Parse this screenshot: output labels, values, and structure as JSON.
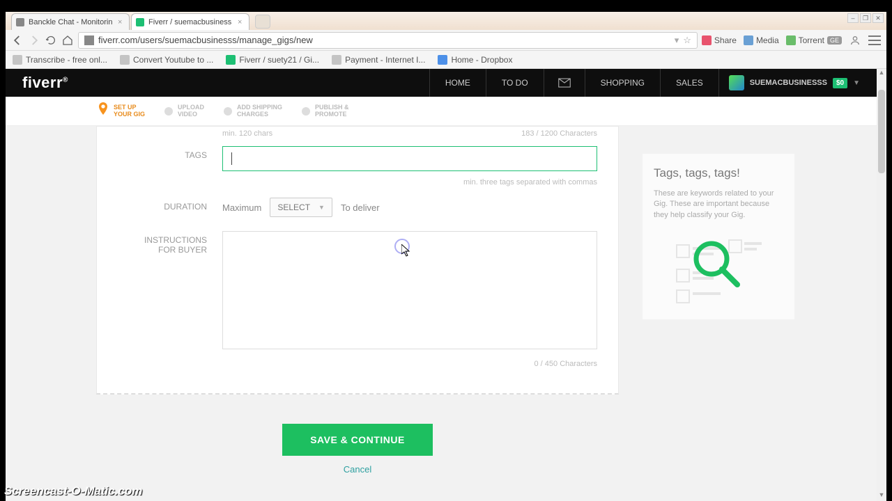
{
  "browser": {
    "tabs": [
      {
        "title": "Banckle Chat - Monitorin"
      },
      {
        "title": "Fiverr / suemacbusiness"
      }
    ],
    "url": "fiverr.com/users/suemacbusinesss/manage_gigs/new",
    "window_controls": {
      "min": "–",
      "max": "❐",
      "close": "✕"
    },
    "extensions": {
      "share": "Share",
      "media": "Media",
      "torrent": "Torrent",
      "ge": "GE"
    },
    "bookmarks": [
      "Transcribe - free onl...",
      "Convert Youtube to ...",
      "Fiverr / suety21 / Gi...",
      "Payment - Internet I...",
      "Home - Dropbox"
    ]
  },
  "nav": {
    "logo": "fiverr",
    "items": [
      "HOME",
      "TO DO",
      "SHOPPING",
      "SALES"
    ],
    "username": "SUEMACBUSINESSS",
    "balance": "$0"
  },
  "steps": [
    {
      "line1": "SET UP",
      "line2": "YOUR GIG",
      "active": true
    },
    {
      "line1": "UPLOAD",
      "line2": "VIDEO",
      "active": false
    },
    {
      "line1": "ADD SHIPPING",
      "line2": "CHARGES",
      "active": false
    },
    {
      "line1": "PUBLISH &",
      "line2": "PROMOTE",
      "active": false
    }
  ],
  "form": {
    "desc_min_hint": "min. 120 chars",
    "desc_counter": "183 / 1200 Characters",
    "tags_label": "TAGS",
    "tags_value": "",
    "tags_hint": "min. three tags separated with commas",
    "duration_label": "DURATION",
    "duration_max": "Maximum",
    "duration_select": "SELECT",
    "duration_deliver": "To deliver",
    "instructions_label1": "INSTRUCTIONS",
    "instructions_label2": "FOR BUYER",
    "instructions_value": "",
    "instructions_counter": "0 / 450 Characters",
    "save_btn": "SAVE & CONTINUE",
    "cancel_btn": "Cancel"
  },
  "tip": {
    "title": "Tags, tags, tags!",
    "text": "These are keywords related to your Gig. These are important because they help classify your Gig."
  },
  "watermark": "Screencast-O-Matic.com"
}
